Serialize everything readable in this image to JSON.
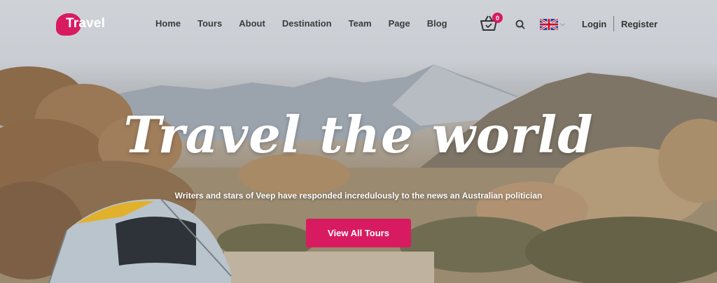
{
  "brand": {
    "logo_text": "Travel",
    "accent_color": "#d81b60"
  },
  "nav": {
    "items": [
      "Home",
      "Tours",
      "About",
      "Destination",
      "Team",
      "Page",
      "Blog"
    ],
    "cart_count": "0",
    "language_flag": "uk-flag-icon",
    "login_label": "Login",
    "register_label": "Register"
  },
  "hero": {
    "title": "Travel the world",
    "subtitle": "Writers and stars of Veep have responded incredulously to the news an Australian politician",
    "cta_label": "View All Tours"
  }
}
